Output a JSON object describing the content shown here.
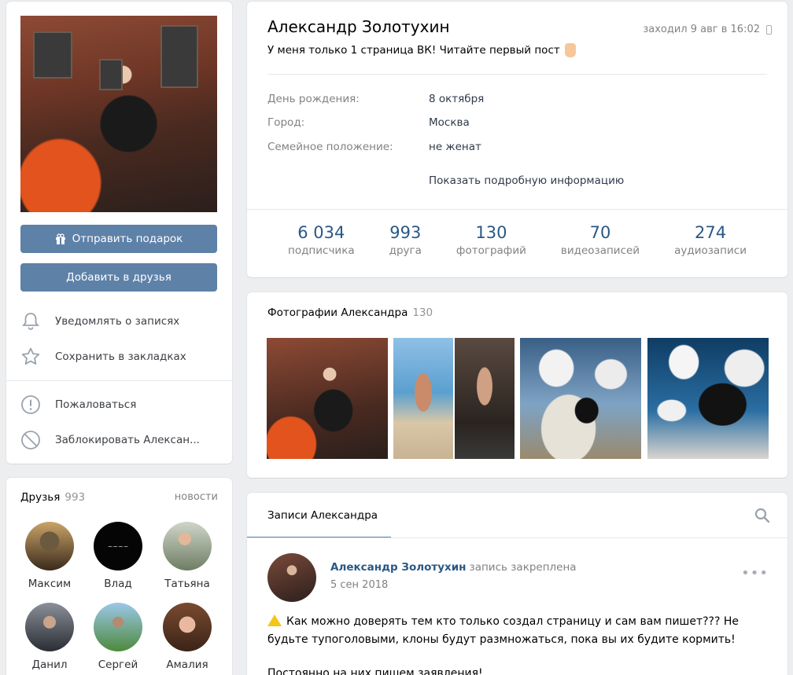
{
  "sidebar": {
    "gift_button": "Отправить подарок",
    "add_friend_button": "Добавить в друзья",
    "actions": [
      {
        "label": "Уведомлять о записях",
        "icon": "bell-icon"
      },
      {
        "label": "Сохранить в закладках",
        "icon": "star-icon"
      },
      {
        "label": "Пожаловаться",
        "icon": "report-icon"
      },
      {
        "label": "Заблокировать Алексан...",
        "icon": "block-icon"
      }
    ]
  },
  "friends": {
    "title": "Друзья",
    "count": "993",
    "news_link": "новости",
    "items": [
      {
        "name": "Максим"
      },
      {
        "name": "Влад"
      },
      {
        "name": "Татьяна"
      },
      {
        "name": "Данил"
      },
      {
        "name": "Сергей"
      },
      {
        "name": "Амалия"
      }
    ]
  },
  "profile": {
    "name": "Александр Золотухин",
    "status": "У меня только 1 страница ВК! Читайте первый пост",
    "last_seen": "заходил 9 авг в 16:02",
    "info": [
      {
        "key": "День рождения:",
        "value": "8 октября"
      },
      {
        "key": "Город:",
        "value": "Москва"
      },
      {
        "key": "Семейное положение:",
        "value": "не женат"
      }
    ],
    "more_link": "Показать подробную информацию",
    "stats": [
      {
        "number": "6 034",
        "label": "подписчика"
      },
      {
        "number": "993",
        "label": "друга"
      },
      {
        "number": "130",
        "label": "фотографий"
      },
      {
        "number": "70",
        "label": "видеозаписей"
      },
      {
        "number": "274",
        "label": "аудиозаписи"
      }
    ]
  },
  "photos": {
    "title": "Фотографии Александра",
    "count": "130"
  },
  "wall": {
    "tab": "Записи Александра",
    "post": {
      "author": "Александр Золотухин",
      "pinned": "запись закреплена",
      "date": "5 сен 2018",
      "text": "Как можно доверять тем кто только создал страницу и сам вам пишет??? Не будьте тупоголовыми, клоны будут размножаться, пока вы их будите кормить!",
      "text2": "Постоянно на них пишем заявления!"
    }
  },
  "colors": {
    "accent": "#5e81a8",
    "link": "#2a5885",
    "muted": "#828282",
    "background": "#edeef0"
  }
}
